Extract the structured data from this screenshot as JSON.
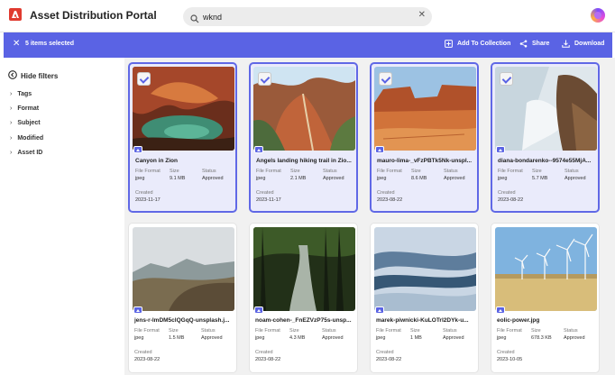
{
  "app": {
    "title": "Asset Distribution Portal"
  },
  "search": {
    "value": "wknd",
    "placeholder": "Search"
  },
  "selection": {
    "count_label": "5 items selected",
    "actions": {
      "add": "Add To Collection",
      "share": "Share",
      "download": "Download"
    }
  },
  "sidebar": {
    "hide_filters": "Hide filters",
    "filters": [
      "Tags",
      "Format",
      "Subject",
      "Modified",
      "Asset ID"
    ]
  },
  "labels": {
    "file_format": "File Format",
    "size": "Size",
    "status": "Status",
    "created": "Created"
  },
  "colors": {
    "accent": "#5a63e4",
    "logo": "#e03a2f",
    "selected_bg": "#eaebfb"
  },
  "assets": [
    {
      "title": "Canyon in Zion",
      "format": "jpeg",
      "size": "9.1 MB",
      "status": "Approved",
      "created": "2023-11-17",
      "selected": true
    },
    {
      "title": "Angels landing hiking trail in Zio...",
      "format": "jpeg",
      "size": "2.1 MB",
      "status": "Approved",
      "created": "2023-11-17",
      "selected": true
    },
    {
      "title": "mauro-lima-_vFzPBTk5Nk-unspl...",
      "format": "jpeg",
      "size": "8.6 MB",
      "status": "Approved",
      "created": "2023-08-22",
      "selected": true
    },
    {
      "title": "diana-bondarenko--9574e55MjA...",
      "format": "jpeg",
      "size": "5.7 MB",
      "status": "Approved",
      "created": "2023-08-22",
      "selected": true
    },
    {
      "title": "jens-r-lmDM5clQGqQ-unsplash.j...",
      "format": "jpeg",
      "size": "1.5 MB",
      "status": "Approved",
      "created": "2023-08-22",
      "selected": false
    },
    {
      "title": "noam-cohen-_FnEZVzP75s-unsp...",
      "format": "jpeg",
      "size": "4.3 MB",
      "status": "Approved",
      "created": "2023-08-22",
      "selected": false
    },
    {
      "title": "marek-piwnicki-KuLOTrl2DYk-u...",
      "format": "jpeg",
      "size": "1 MB",
      "status": "Approved",
      "created": "2023-08-22",
      "selected": false
    },
    {
      "title": "eolic-power.jpg",
      "format": "jpeg",
      "size": "678.3 KB",
      "status": "Approved",
      "created": "2023-10-05",
      "selected": false
    }
  ]
}
